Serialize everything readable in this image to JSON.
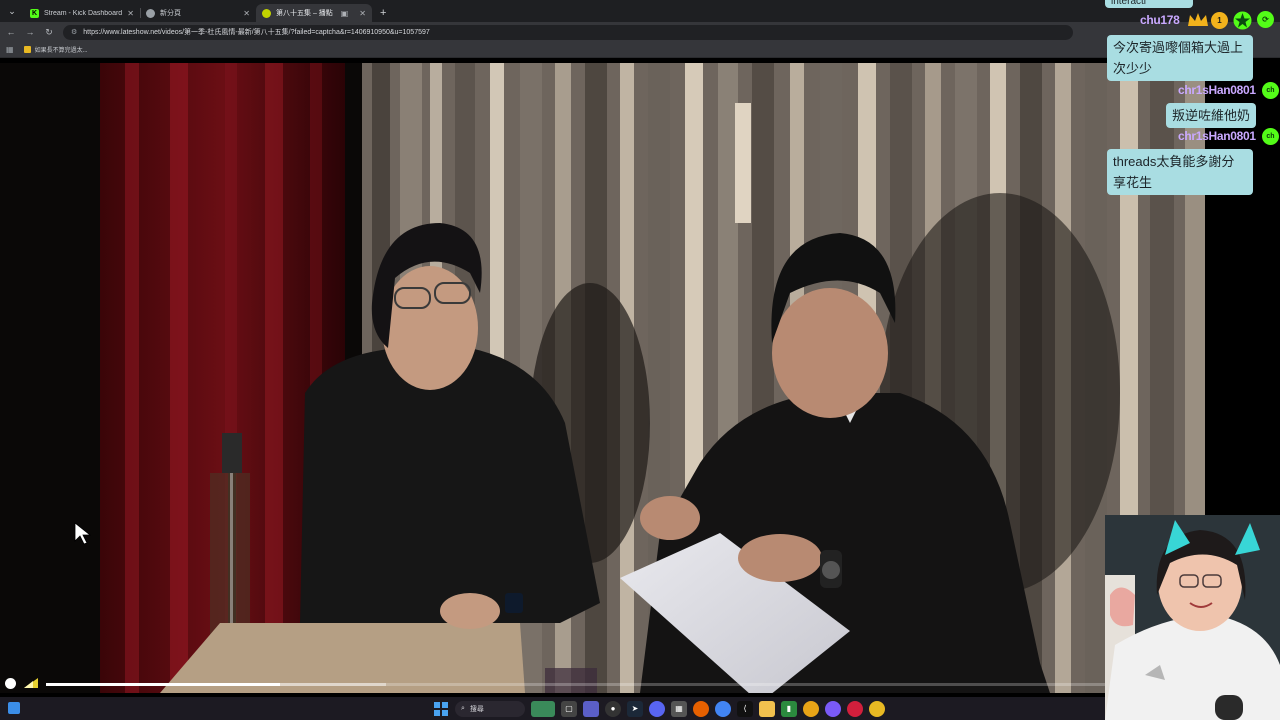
{
  "browser": {
    "tabs": [
      {
        "title": "Stream - Kick Dashboard",
        "favicon_color": "#53fc18",
        "favicon_letter": "K",
        "active": false
      },
      {
        "title": "新分頁",
        "favicon_color": "#9aa0a6",
        "favicon_letter": "",
        "active": false
      },
      {
        "title": "第八十五集 – 播點",
        "favicon_color": "#c3d400",
        "favicon_letter": "",
        "active": true
      }
    ],
    "new_tab_symbol": "+",
    "url": "https://www.lateshow.net/videos/第一季-杜氏風情-最新/第八十五集/?failed=captcha&r=1406910950&u=1057597",
    "bookmark": "如果長不算完過太..."
  },
  "video": {
    "progress": 0.22,
    "buffered": 0.32
  },
  "chat": {
    "top_partial": "interacti",
    "messages": [
      {
        "user": "chu178",
        "text": "今次寄過嚟個箱大過上次少少"
      },
      {
        "user": "chr1sHan0801",
        "text": "叛逆咗維他奶"
      },
      {
        "user": "chr1sHan0801",
        "text": "threads太負能多謝分享花生"
      }
    ],
    "badge_number": "1",
    "badge_ch": "ch"
  },
  "taskbar": {
    "search_label": "搜尋"
  },
  "colors": {
    "bubble": "#a9dde2",
    "username": "#c9a8ff",
    "accent_green": "#53fc18"
  }
}
